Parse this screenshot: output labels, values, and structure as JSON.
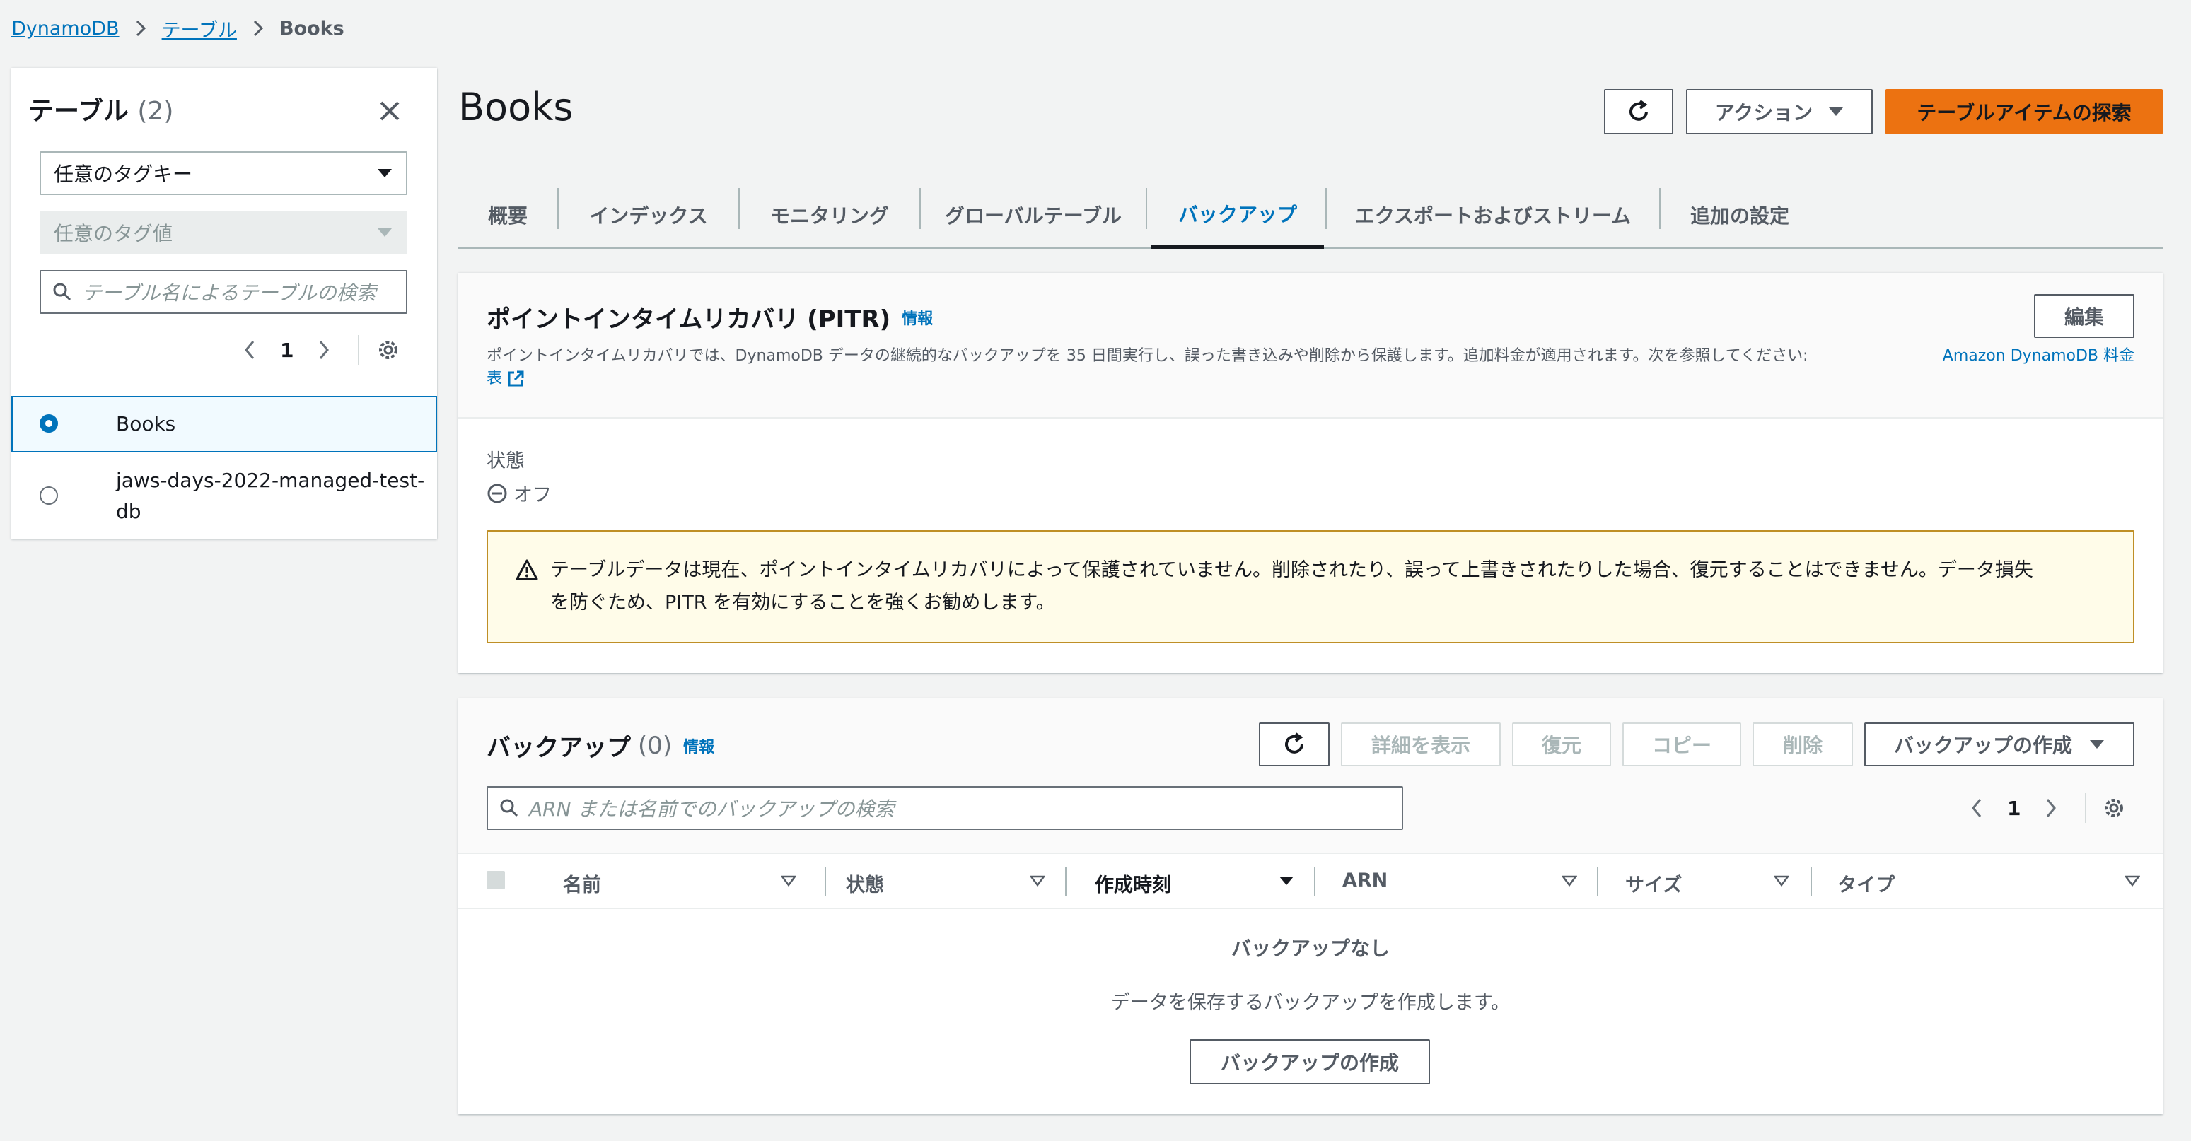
{
  "breadcrumb": {
    "root": "DynamoDB",
    "tables": "テーブル",
    "current": "Books"
  },
  "sidebar": {
    "title": "テーブル",
    "count": "(2)",
    "tag_key_placeholder": "任意のタグキー",
    "tag_value_placeholder": "任意のタグ値",
    "search_placeholder": "テーブル名によるテーブルの検索",
    "page": "1",
    "tables": [
      {
        "name": "Books",
        "selected": true
      },
      {
        "name_line1": "jaws-days-2022-managed-test-",
        "name_line2": "db",
        "selected": false
      }
    ]
  },
  "header": {
    "title": "Books",
    "actions_label": "アクション",
    "explore_label": "テーブルアイテムの探索"
  },
  "tabs": [
    "概要",
    "インデックス",
    "モニタリング",
    "グローバルテーブル",
    "バックアップ",
    "エクスポートおよびストリーム",
    "追加の設定"
  ],
  "active_tab": "バックアップ",
  "pitr": {
    "title": "ポイントインタイムリカバリ (PITR)",
    "info": "情報",
    "edit_label": "編集",
    "description": "ポイントインタイムリカバリでは、DynamoDB データの継続的なバックアップを 35 日間実行し、誤った書き込みや削除から保護します。追加料金が適用されます。次を参照してください: ",
    "pricing_link_a": "Amazon DynamoDB 料金",
    "pricing_link_b": "表",
    "status_label": "状態",
    "status_value": "オフ",
    "warning_line1": "テーブルデータは現在、ポイントインタイムリカバリによって保護されていません。削除されたり、誤って上書きされたりした場合、復元することはできません。データ損失",
    "warning_line2": "を防ぐため、PITR を有効にすることを強くお勧めします。"
  },
  "backups": {
    "title": "バックアップ",
    "count": "(0)",
    "info": "情報",
    "details_label": "詳細を表示",
    "restore_label": "復元",
    "copy_label": "コピー",
    "delete_label": "削除",
    "create_label": "バックアップの作成",
    "search_placeholder": "ARN または名前でのバックアップの検索",
    "page": "1",
    "columns": [
      "名前",
      "状態",
      "作成時刻",
      "ARN",
      "サイズ",
      "タイプ"
    ],
    "empty_title": "バックアップなし",
    "empty_desc": "データを保存するバックアップを作成します。",
    "empty_create_label": "バックアップの作成"
  },
  "colors": {
    "accent": "#0073bb",
    "primary_button": "#ec7211",
    "warning_border": "#bf8f26"
  }
}
